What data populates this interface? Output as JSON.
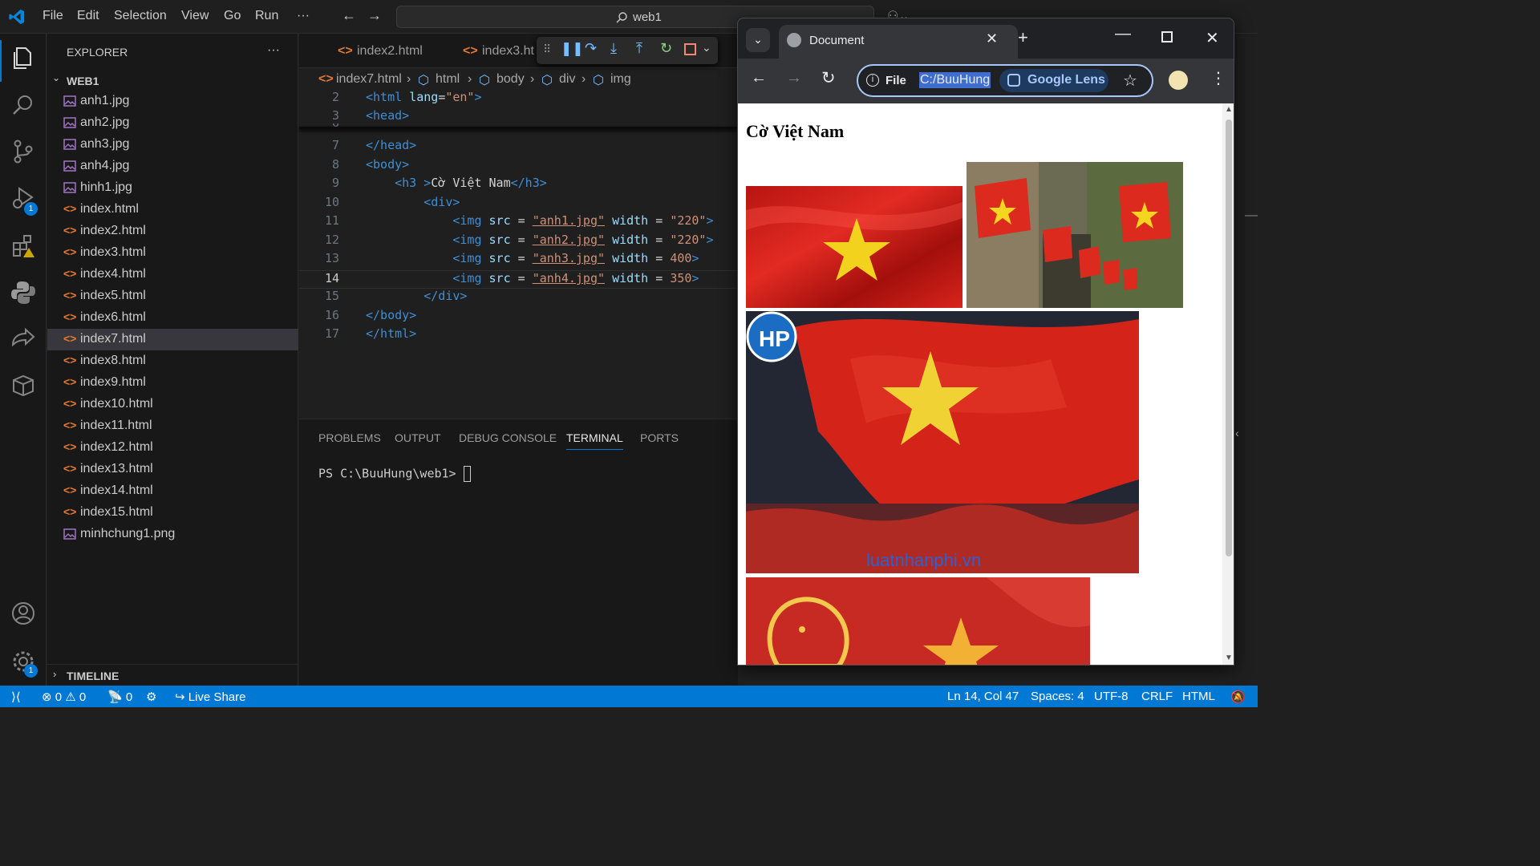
{
  "titlebar": {
    "menu": [
      "File",
      "Edit",
      "Selection",
      "View",
      "Go",
      "Run",
      "···"
    ],
    "search": "web1"
  },
  "sidebar": {
    "title": "EXPLORER",
    "more": "···",
    "folder": "WEB1",
    "files": [
      {
        "name": "anh1.jpg",
        "type": "image"
      },
      {
        "name": "anh2.jpg",
        "type": "image"
      },
      {
        "name": "anh3.jpg",
        "type": "image"
      },
      {
        "name": "anh4.jpg",
        "type": "image"
      },
      {
        "name": "hinh1.jpg",
        "type": "image"
      },
      {
        "name": "index.html",
        "type": "html"
      },
      {
        "name": "index2.html",
        "type": "html"
      },
      {
        "name": "index3.html",
        "type": "html"
      },
      {
        "name": "index4.html",
        "type": "html"
      },
      {
        "name": "index5.html",
        "type": "html"
      },
      {
        "name": "index6.html",
        "type": "html"
      },
      {
        "name": "index7.html",
        "type": "html",
        "active": true
      },
      {
        "name": "index8.html",
        "type": "html"
      },
      {
        "name": "index9.html",
        "type": "html"
      },
      {
        "name": "index10.html",
        "type": "html"
      },
      {
        "name": "index11.html",
        "type": "html"
      },
      {
        "name": "index12.html",
        "type": "html"
      },
      {
        "name": "index13.html",
        "type": "html"
      },
      {
        "name": "index14.html",
        "type": "html"
      },
      {
        "name": "index15.html",
        "type": "html"
      },
      {
        "name": "minhchung1.png",
        "type": "image"
      }
    ],
    "timeline": "TIMELINE"
  },
  "activity": {
    "run_badge": "1",
    "settings_badge": "1"
  },
  "editor": {
    "tabs": [
      "index2.html",
      "index3.ht"
    ],
    "breadcrumbs": [
      "index7.html",
      "html",
      "body",
      "div",
      "img"
    ],
    "lines": [
      {
        "n": "2",
        "parts": [
          [
            "tg",
            "<html "
          ],
          [
            "an",
            "lang"
          ],
          [
            "tx",
            "="
          ],
          [
            "sv",
            "\"en\""
          ],
          [
            "tg",
            ">"
          ]
        ]
      },
      {
        "n": "3",
        "parts": [
          [
            "tg",
            "<head>"
          ]
        ]
      },
      {
        "n": "7",
        "parts": [
          [
            "tg",
            "</head>"
          ]
        ]
      },
      {
        "n": "8",
        "parts": [
          [
            "tg",
            "<body>"
          ]
        ]
      },
      {
        "n": "9",
        "parts": [
          [
            "tx",
            "    "
          ],
          [
            "tg",
            "<h3 >"
          ],
          [
            "tx",
            "Cờ Việt Nam"
          ],
          [
            "tg",
            "</h3>"
          ]
        ]
      },
      {
        "n": "10",
        "parts": [
          [
            "tx",
            "        "
          ],
          [
            "tg",
            "<div>"
          ]
        ]
      },
      {
        "n": "11",
        "parts": [
          [
            "tx",
            "            "
          ],
          [
            "tg",
            "<img "
          ],
          [
            "an",
            "src"
          ],
          [
            "tx",
            " = "
          ],
          [
            "sv",
            "\"anh1.jpg\""
          ],
          [
            "tx",
            " "
          ],
          [
            "an",
            "width"
          ],
          [
            "tx",
            " = "
          ],
          [
            "sv",
            "\"220\""
          ],
          [
            "tg",
            ">"
          ]
        ]
      },
      {
        "n": "12",
        "parts": [
          [
            "tx",
            "            "
          ],
          [
            "tg",
            "<img "
          ],
          [
            "an",
            "src"
          ],
          [
            "tx",
            " = "
          ],
          [
            "sv",
            "\"anh2.jpg\""
          ],
          [
            "tx",
            " "
          ],
          [
            "an",
            "width"
          ],
          [
            "tx",
            " = "
          ],
          [
            "sv",
            "\"220\""
          ],
          [
            "tg",
            ">"
          ]
        ]
      },
      {
        "n": "13",
        "parts": [
          [
            "tx",
            "            "
          ],
          [
            "tg",
            "<img "
          ],
          [
            "an",
            "src"
          ],
          [
            "tx",
            " = "
          ],
          [
            "sv",
            "\"anh3.jpg\""
          ],
          [
            "tx",
            " "
          ],
          [
            "an",
            "width"
          ],
          [
            "tx",
            " = "
          ],
          [
            "sv",
            "400"
          ],
          [
            "tg",
            ">"
          ]
        ]
      },
      {
        "n": "14",
        "parts": [
          [
            "tx",
            "            "
          ],
          [
            "tg",
            "<img "
          ],
          [
            "an",
            "src"
          ],
          [
            "tx",
            " = "
          ],
          [
            "sv",
            "\"anh4.jpg\""
          ],
          [
            "tx",
            " "
          ],
          [
            "an",
            "width"
          ],
          [
            "tx",
            " = "
          ],
          [
            "sv",
            "350"
          ],
          [
            "tg",
            ">"
          ]
        ]
      },
      {
        "n": "15",
        "parts": [
          [
            "tx",
            "        "
          ],
          [
            "tg",
            "</div>"
          ]
        ]
      },
      {
        "n": "16",
        "parts": [
          [
            "tg",
            "</body>"
          ]
        ]
      },
      {
        "n": "17",
        "parts": [
          [
            "tg",
            "</html>"
          ]
        ]
      }
    ]
  },
  "panel": {
    "tabs": [
      "PROBLEMS",
      "OUTPUT",
      "DEBUG CONSOLE",
      "TERMINAL",
      "PORTS"
    ],
    "active_tab": "TERMINAL",
    "prompt": "PS C:\\BuuHung\\web1> "
  },
  "statusbar": {
    "errors": "0",
    "warnings": "0",
    "ports": "0",
    "live_share": "Live Share",
    "position": "Ln 14, Col 47",
    "spaces": "Spaces: 4",
    "encoding": "UTF-8",
    "eol": "CRLF",
    "language": "HTML"
  },
  "browser": {
    "tab_title": "Document",
    "omnibox_scheme": "File",
    "omnibox_url": "C:/BuuHung",
    "lens_label": "Google Lens",
    "page_heading": "Cờ Việt Nam",
    "watermark": "luatnhanphi.vn"
  },
  "colors": {
    "accent": "#0078d4",
    "flag_red": "#da251d",
    "flag_yellow": "#ffde00"
  }
}
